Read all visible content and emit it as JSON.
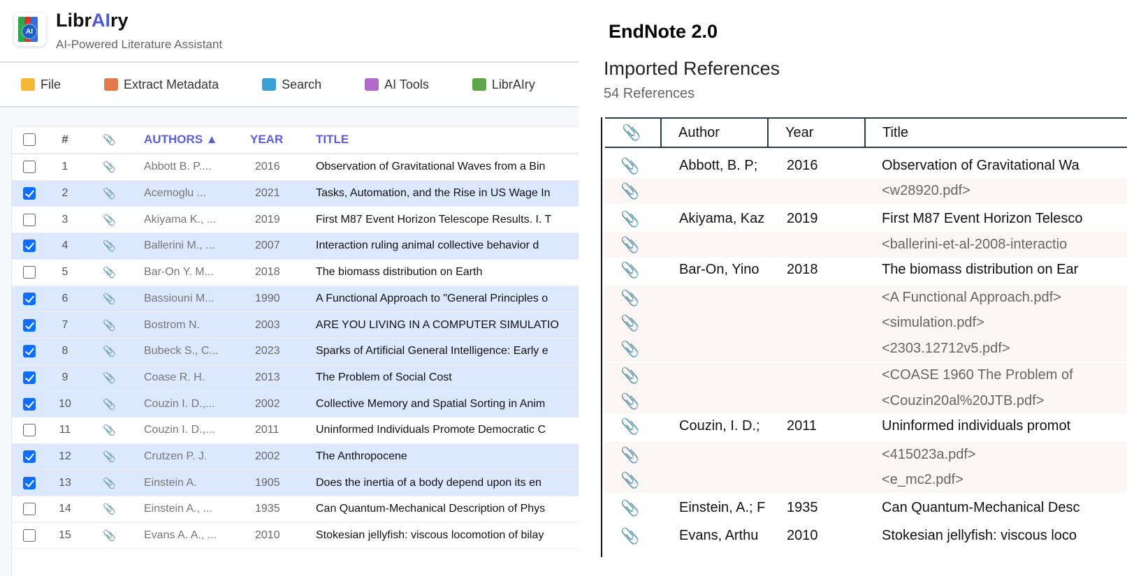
{
  "app": {
    "name_pre": "Libr",
    "name_ai": "AI",
    "name_post": "ry",
    "tagline": "AI-Powered Literature Assistant"
  },
  "toolbar": [
    {
      "label": "File",
      "icon": "folder-icon",
      "color": "#f5b731"
    },
    {
      "label": "Extract Metadata",
      "icon": "document-edit-icon",
      "color": "#e07a4a"
    },
    {
      "label": "Search",
      "icon": "magnifier-icon",
      "color": "#3aa0d8"
    },
    {
      "label": "AI Tools",
      "icon": "robot-icon",
      "color": "#b06ac8"
    },
    {
      "label": "LibrAIry",
      "icon": "books-icon",
      "color": "#5aa84a"
    }
  ],
  "table": {
    "headers": {
      "num": "#",
      "clip": "📎",
      "authors": "AUTHORS ▲",
      "year": "YEAR",
      "title": "TITLE"
    },
    "rows": [
      {
        "n": "1",
        "sel": false,
        "authors": "Abbott B. P....",
        "year": "2016",
        "title": "Observation of Gravitational Waves from a Bin"
      },
      {
        "n": "2",
        "sel": true,
        "authors": "Acemoglu ...",
        "year": "2021",
        "title": "Tasks, Automation, and the Rise in US Wage In"
      },
      {
        "n": "3",
        "sel": false,
        "authors": "Akiyama K., ...",
        "year": "2019",
        "title": "First M87 Event Horizon Telescope Results. I. T"
      },
      {
        "n": "4",
        "sel": true,
        "authors": "Ballerini M., ...",
        "year": "2007",
        "title": "Interaction ruling animal collective behavior d"
      },
      {
        "n": "5",
        "sel": false,
        "authors": "Bar-On Y. M...",
        "year": "2018",
        "title": "The biomass distribution on Earth"
      },
      {
        "n": "6",
        "sel": true,
        "authors": "Bassiouni M...",
        "year": "1990",
        "title": "A Functional Approach to \"General Principles o"
      },
      {
        "n": "7",
        "sel": true,
        "authors": "Bostrom N.",
        "year": "2003",
        "title": "ARE YOU LIVING IN A COMPUTER SIMULATIO"
      },
      {
        "n": "8",
        "sel": true,
        "authors": "Bubeck S., C...",
        "year": "2023",
        "title": "Sparks of Artificial General Intelligence: Early e"
      },
      {
        "n": "9",
        "sel": true,
        "authors": "Coase R. H.",
        "year": "2013",
        "title": "The Problem of Social Cost"
      },
      {
        "n": "10",
        "sel": true,
        "authors": "Couzin I. D.,...",
        "year": "2002",
        "title": "Collective Memory and Spatial Sorting in Anim"
      },
      {
        "n": "11",
        "sel": false,
        "authors": "Couzin I. D.,...",
        "year": "2011",
        "title": "Uninformed Individuals Promote Democratic C"
      },
      {
        "n": "12",
        "sel": true,
        "authors": "Crutzen P. J.",
        "year": "2002",
        "title": "The Anthropocene"
      },
      {
        "n": "13",
        "sel": true,
        "authors": "Einstein A.",
        "year": "1905",
        "title": "Does the inertia of a body depend upon its en"
      },
      {
        "n": "14",
        "sel": false,
        "authors": "Einstein A., ...",
        "year": "1935",
        "title": "Can Quantum-Mechanical Description of Phys"
      },
      {
        "n": "15",
        "sel": false,
        "authors": "Evans A. A., ...",
        "year": "2010",
        "title": "Stokesian jellyfish: viscous locomotion of bilay"
      }
    ]
  },
  "endnote": {
    "title": "EndNote 2.0",
    "subtitle": "Imported References",
    "count": "54 References",
    "headers": {
      "author": "Author",
      "year": "Year",
      "title": "Title"
    },
    "rows": [
      {
        "type": "main",
        "author": "Abbott, B.  P;",
        "year": "2016",
        "title": "Observation of Gravitational Wa"
      },
      {
        "type": "att",
        "title": "<w28920.pdf>"
      },
      {
        "type": "main",
        "author": "Akiyama, Kaz",
        "year": "2019",
        "title": "First M87 Event Horizon Telesco"
      },
      {
        "type": "att",
        "title": "<ballerini-et-al-2008-interactio"
      },
      {
        "type": "main",
        "author": "Bar-On, Yino",
        "year": "2018",
        "title": "The biomass distribution on Ear"
      },
      {
        "type": "att",
        "title": "<A Functional Approach.pdf>"
      },
      {
        "type": "att",
        "title": "<simulation.pdf>"
      },
      {
        "type": "att",
        "title": "<2303.12712v5.pdf>"
      },
      {
        "type": "att",
        "title": "<COASE 1960 The  Problem of"
      },
      {
        "type": "att",
        "title": "<Couzin20al%20JTB.pdf>"
      },
      {
        "type": "main",
        "author": "Couzin, I. D.;",
        "year": "2011",
        "title": "Uninformed individuals promot"
      },
      {
        "type": "att",
        "title": "<415023a.pdf>"
      },
      {
        "type": "att",
        "title": "<e_mc2.pdf>"
      },
      {
        "type": "main",
        "author": "Einstein, A.; F",
        "year": "1935",
        "title": "Can Quantum-Mechanical Desc"
      },
      {
        "type": "main",
        "author": "Evans, Arthu",
        "year": "2010",
        "title": "Stokesian jellyfish: viscous loco"
      }
    ]
  },
  "colors": {
    "accent": "#5b5fd8",
    "selected_row": "#dbe8fd",
    "checkbox": "#0d6efd",
    "attachment_row": "#fcf7f5"
  }
}
